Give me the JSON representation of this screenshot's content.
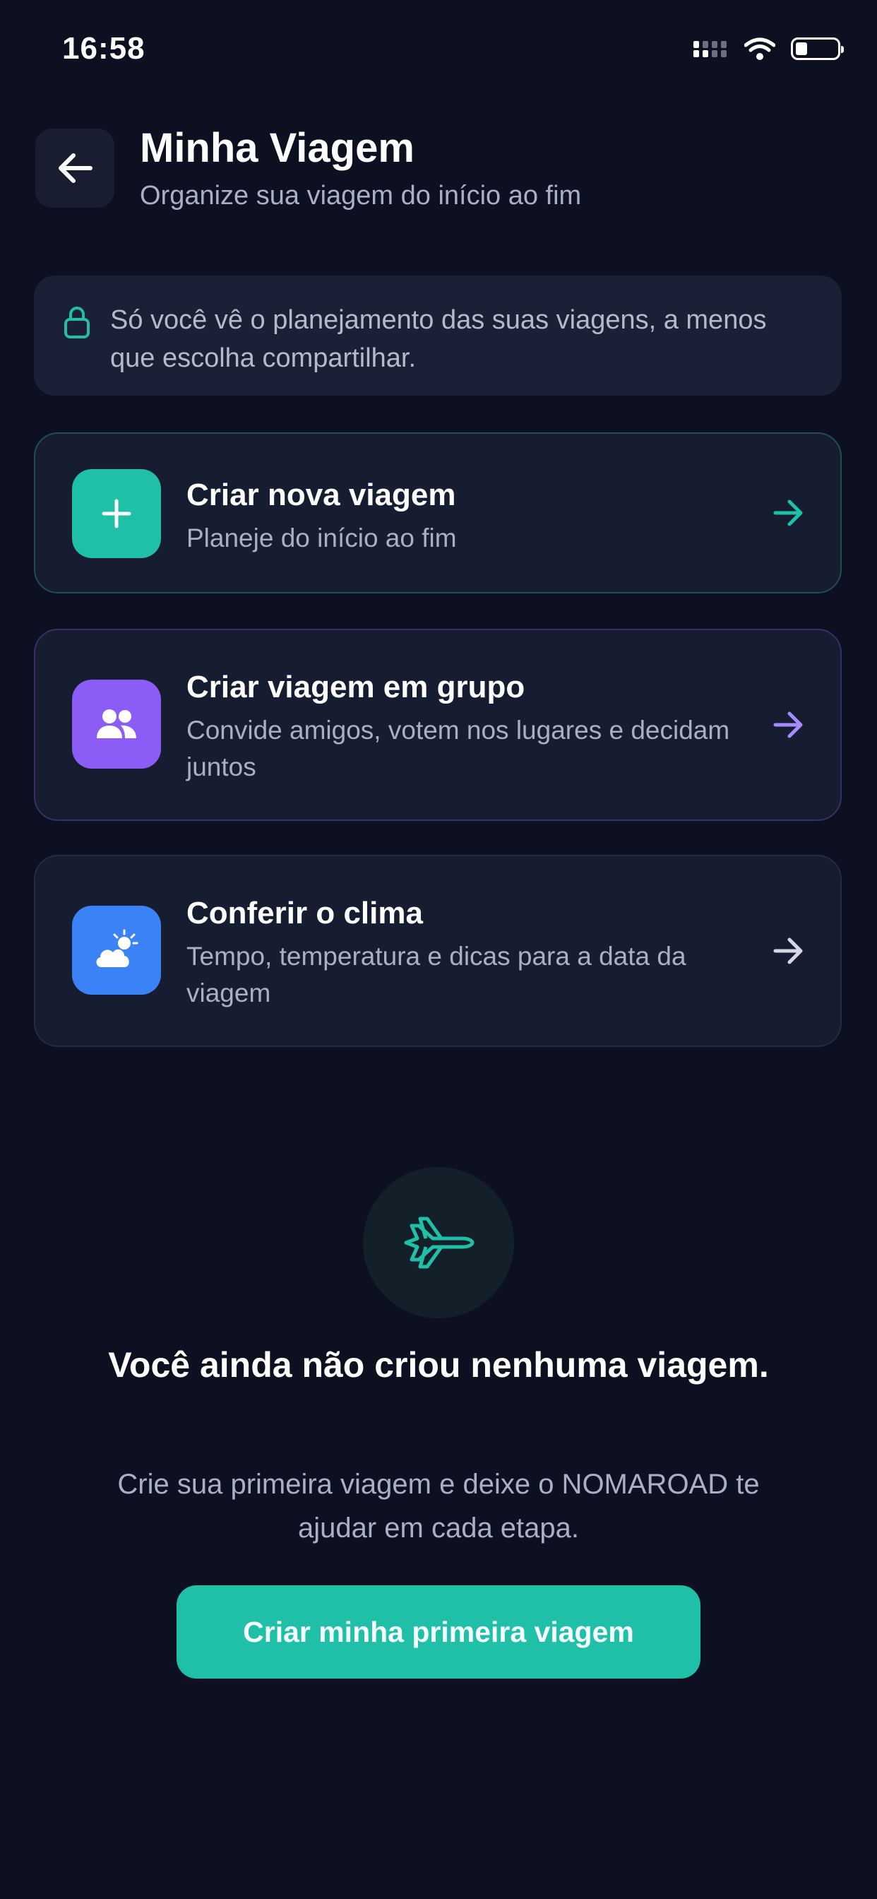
{
  "status_bar": {
    "time": "16:58"
  },
  "header": {
    "title": "Minha Viagem",
    "subtitle": "Organize sua viagem do início ao fim"
  },
  "privacy_notice": {
    "icon": "lock-icon",
    "text": "Só você vê o planejamento das suas viagens, a menos que escolha compartilhar."
  },
  "actions": [
    {
      "icon": "plus-icon",
      "title": "Criar nova viagem",
      "description": "Planeje do início ao fim",
      "accent": "#1fbfa8"
    },
    {
      "icon": "group-icon",
      "title": "Criar viagem em grupo",
      "description": "Convide amigos, votem nos lugares e decidam juntos",
      "accent": "#8b5cf6"
    },
    {
      "icon": "weather-icon",
      "title": "Conferir o clima",
      "description": "Tempo, temperatura e dicas para a data da viagem",
      "accent": "#3b82f6"
    }
  ],
  "empty_state": {
    "icon": "airplane-icon",
    "title": "Você ainda não criou nenhuma viagem.",
    "description": "Crie sua primeira viagem e deixe o NOMAROAD te ajudar em cada etapa.",
    "button_label": "Criar minha primeira viagem"
  },
  "colors": {
    "background": "#0c1020",
    "card": "#161d30",
    "teal": "#1fbfa8",
    "purple": "#8b5cf6",
    "blue": "#3b82f6"
  }
}
